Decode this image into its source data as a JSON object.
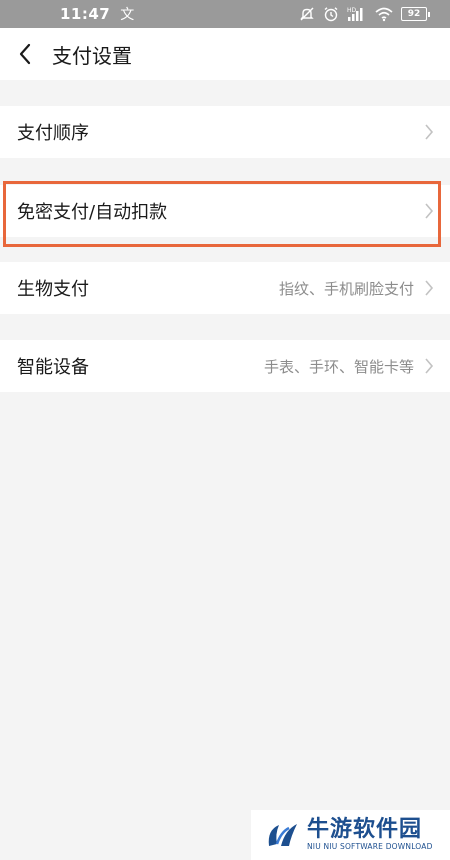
{
  "status_bar": {
    "time": "11:47",
    "carrier_icon_text": "文",
    "network_label": "HD",
    "battery": "92"
  },
  "nav": {
    "title": "支付设置"
  },
  "settings": [
    {
      "label": "支付顺序",
      "value": ""
    },
    {
      "label": "免密支付/自动扣款",
      "value": ""
    },
    {
      "label": "生物支付",
      "value": "指纹、手机刷脸支付"
    },
    {
      "label": "智能设备",
      "value": "手表、手环、智能卡等"
    }
  ],
  "watermark": {
    "title": "牛游软件园",
    "subtitle": "NIU NIU SOFTWARE DOWNLOAD"
  },
  "colors": {
    "highlight": "#e8673b",
    "brand": "#1d4f8f"
  }
}
